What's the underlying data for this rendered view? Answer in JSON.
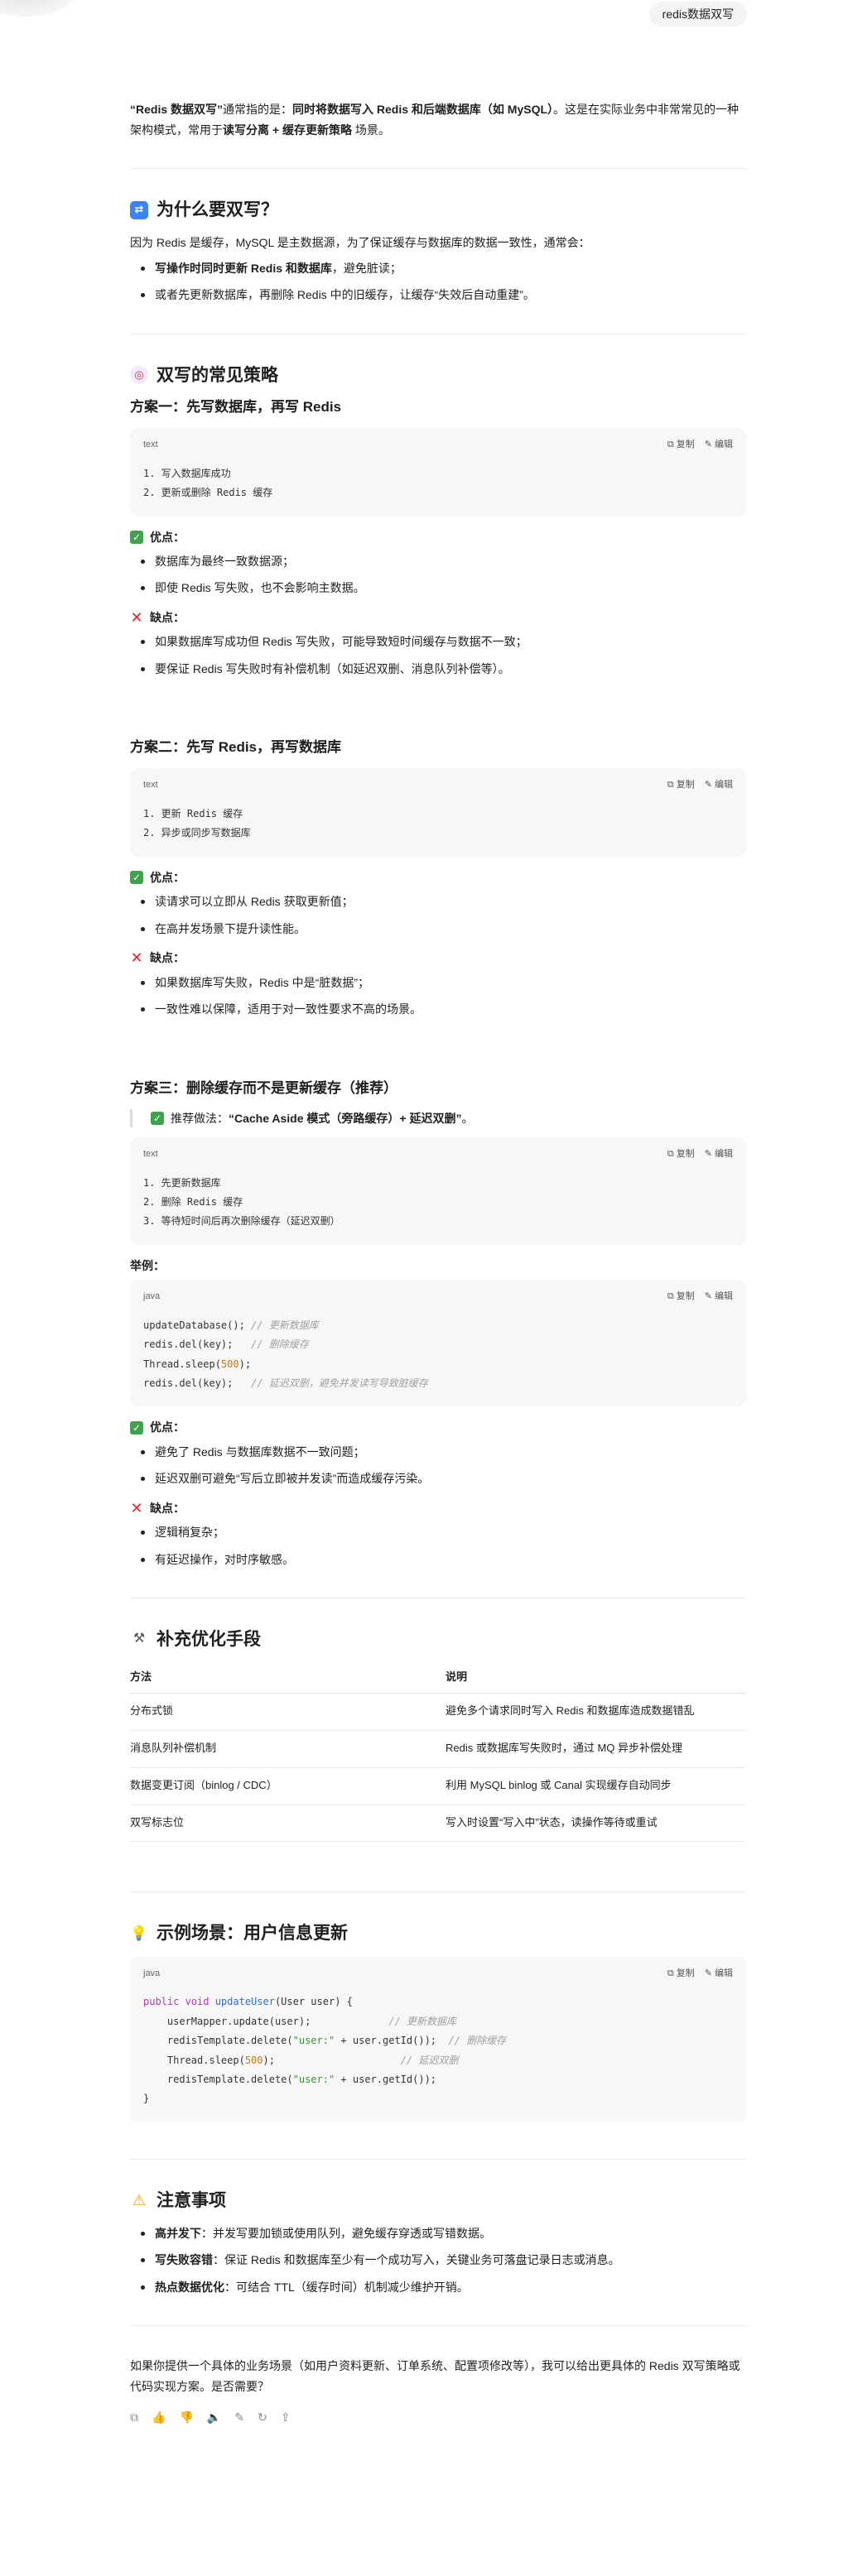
{
  "user_message": "redis数据双写",
  "intro": {
    "p1": "“Redis 数据双写”",
    "p2": "通常指的是：",
    "p3": "同时将数据写入 Redis 和后端数据库（如 MySQL）",
    "p4": "。这是在实际业务中非常常见的一种架构模式，常用于",
    "p5": "读写分离 + 缓存更新策略",
    "p6": "场景。"
  },
  "why": {
    "title": "为什么要双写？",
    "desc": "因为 Redis 是缓存，MySQL 是主数据源，为了保证缓存与数据库的数据一致性，通常会：",
    "item1_bold": "写操作时同时更新 Redis 和数据库",
    "item1_rest": "，避免脏读；",
    "item2": "或者先更新数据库，再删除 Redis 中的旧缓存，让缓存“失效后自动重建”。"
  },
  "strategies": {
    "title": "双写的常见策略",
    "copy_label": "复制",
    "edit_label": "编辑",
    "lang_text": "text",
    "lang_java": "java",
    "pros_label": "优点：",
    "cons_label": "缺点：",
    "plan1": {
      "title": "方案一：先写数据库，再写 Redis",
      "code": [
        "1. 写入数据库成功",
        "2. 更新或删除 Redis 缓存"
      ],
      "pros": [
        "数据库为最终一致数据源；",
        "即使 Redis 写失败，也不会影响主数据。"
      ],
      "cons": [
        "如果数据库写成功但 Redis 写失败，可能导致短时间缓存与数据不一致；",
        "要保证 Redis 写失败时有补偿机制（如延迟双删、消息队列补偿等）。"
      ]
    },
    "plan2": {
      "title": "方案二：先写 Redis，再写数据库",
      "code": [
        "1. 更新 Redis 缓存",
        "2. 异步或同步写数据库"
      ],
      "pros": [
        "读请求可以立即从 Redis 获取更新值；",
        "在高并发场景下提升读性能。"
      ],
      "cons": [
        "如果数据库写失败，Redis 中是“脏数据”；",
        "一致性难以保障，适用于对一致性要求不高的场景。"
      ]
    },
    "plan3": {
      "title": "方案三：删除缓存而不是更新缓存（推荐）",
      "quote_prefix": "推荐做法：",
      "quote_bold": "“Cache Aside 模式（旁路缓存）+ 延迟双删”",
      "quote_suffix": "。",
      "code": [
        "1. 先更新数据库",
        "2. 删除 Redis 缓存",
        "3. 等待短时间后再次删除缓存（延迟双删）"
      ],
      "example_label": "举例：",
      "java": [
        {
          "code": "updateDatabase();",
          "comment": "// 更新数据库"
        },
        {
          "code": "redis.del(key);  ",
          "comment": "// 删除缓存"
        },
        {
          "code": "Thread.sleep(",
          "num": "500",
          "after": ");",
          "comment": ""
        },
        {
          "code": "redis.del(key);  ",
          "comment": "// 延迟双删，避免并发读写导致脏缓存"
        }
      ],
      "pros": [
        "避免了 Redis 与数据库数据不一致问题；",
        "延迟双删可避免“写后立即被并发读”而造成缓存污染。"
      ],
      "cons": [
        "逻辑稍复杂；",
        "有延迟操作，对时序敏感。"
      ]
    }
  },
  "optimize": {
    "title": "补充优化手段",
    "headers": [
      "方法",
      "说明"
    ],
    "rows": [
      [
        "分布式锁",
        "避免多个请求同时写入 Redis 和数据库造成数据错乱"
      ],
      [
        "消息队列补偿机制",
        "Redis 或数据库写失败时，通过 MQ 异步补偿处理"
      ],
      [
        "数据变更订阅（binlog / CDC）",
        "利用 MySQL binlog 或 Canal 实现缓存自动同步"
      ],
      [
        "双写标志位",
        "写入时设置“写入中”状态，读操作等待或重试"
      ]
    ]
  },
  "example": {
    "title": "示例场景：用户信息更新",
    "lines": [
      {
        "kw": "public void ",
        "fn": "updateUser",
        "rest": "(User user) {",
        "comment": ""
      },
      {
        "rest": "    userMapper.update(user);             ",
        "comment": "// 更新数据库"
      },
      {
        "rest": "    redisTemplate.delete(",
        "str": "\"user:\"",
        "rest2": " + user.getId());  ",
        "comment": "// 删除缓存"
      },
      {
        "rest": "    Thread.sleep(",
        "num": "500",
        "rest2": ");                     ",
        "comment": "// 延迟双删"
      },
      {
        "rest": "    redisTemplate.delete(",
        "str": "\"user:\"",
        "rest2": " + user.getId());",
        "comment": ""
      },
      {
        "rest": "}",
        "comment": ""
      }
    ]
  },
  "notes": {
    "title": "注意事项",
    "items": [
      {
        "bold": "高并发下",
        "rest": "：并发写要加锁或使用队列，避免缓存穿透或写错数据。"
      },
      {
        "bold": "写失败容错",
        "rest": "：保证 Redis 和数据库至少有一个成功写入，关键业务可落盘记录日志或消息。"
      },
      {
        "bold": "热点数据优化",
        "rest": "：可结合 TTL（缓存时间）机制减少维护开销。"
      }
    ]
  },
  "closing": "如果你提供一个具体的业务场景（如用户资料更新、订单系统、配置项修改等），我可以给出更具体的 Redis 双写策略或代码实现方案。是否需要？",
  "icons": {
    "why": "repeat-icon",
    "strategies": "swirl-icon",
    "optimize": "tools-icon",
    "example": "lightbulb-icon",
    "notes": "warning-icon"
  }
}
